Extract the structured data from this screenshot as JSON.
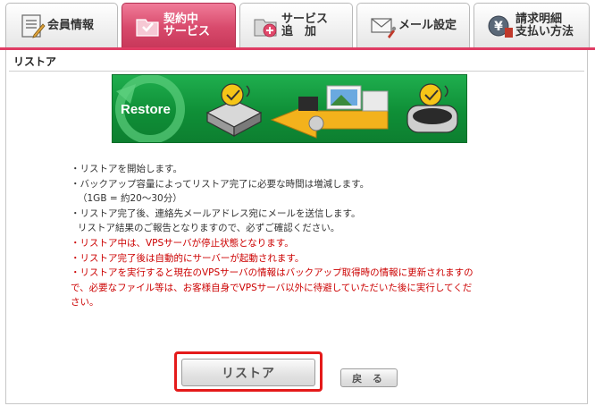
{
  "tabs": [
    {
      "lines": [
        "会員情報"
      ],
      "icon": "member-info-icon",
      "active": false
    },
    {
      "lines": [
        "契約中",
        "サービス"
      ],
      "icon": "contracted-service-icon",
      "active": true
    },
    {
      "lines": [
        "サービス",
        "追　加"
      ],
      "icon": "add-service-icon",
      "active": false
    },
    {
      "lines": [
        "メール設定"
      ],
      "icon": "mail-settings-icon",
      "active": false
    },
    {
      "lines": [
        "請求明細",
        "支払い方法"
      ],
      "icon": "billing-icon",
      "active": false
    }
  ],
  "colors": {
    "accent": "#e03c64",
    "banner": "#12973c",
    "warning": "#cc0000"
  },
  "panel": {
    "title": "リストア"
  },
  "banner": {
    "label": "Restore"
  },
  "instructions": {
    "normal": [
      "・リストアを開始します。",
      "・バックアップ容量によってリストア完了に必要な時間は増減します。",
      "（1GB = 約20～30分）",
      "・リストア完了後、連絡先メールアドレス宛にメールを送信します。",
      "リストア結果のご報告となりますので、必ずご確認ください。"
    ],
    "warnings": [
      "・リストア中は、VPSサーバが停止状態となります。",
      "・リストア完了後は自動的にサーバーが起動されます。",
      "・リストアを実行すると現在のVPSサーバの情報はバックアップ取得時の情報に更新されますの",
      "で、必要なファイル等は、お客様自身でVPSサーバ以外に待避していただいた後に実行してくだ",
      "さい。"
    ]
  },
  "buttons": {
    "restore": "リストア",
    "back": "戻 る"
  }
}
